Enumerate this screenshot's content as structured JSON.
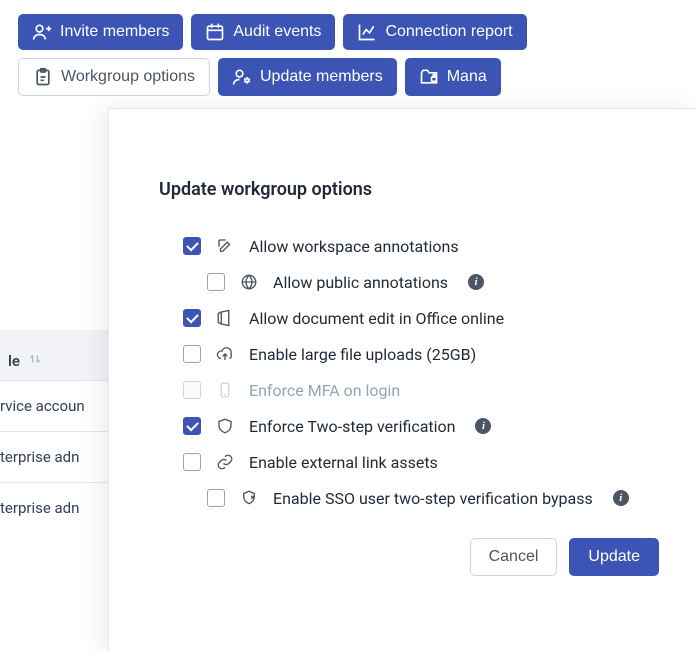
{
  "toolbar": {
    "invite_label": "Invite members",
    "audit_label": "Audit events",
    "conn_report_label": "Connection report",
    "workgroup_options_label": "Workgroup options",
    "update_members_label": "Update members",
    "manage_label": "Mana"
  },
  "bg": {
    "col_header": "le",
    "rows": [
      "rvice accoun",
      "terprise adn",
      "terprise adn"
    ]
  },
  "modal": {
    "title": "Update workgroup options",
    "cancel_label": "Cancel",
    "submit_label": "Update",
    "options": {
      "annotations": "Allow workspace annotations",
      "public_annotations": "Allow public annotations",
      "office": "Allow document edit in Office online",
      "large_upload": "Enable large file uploads (25GB)",
      "mfa": "Enforce MFA on login",
      "twostep": "Enforce Two-step verification",
      "external_link": "Enable external link assets",
      "sso_bypass": "Enable SSO user two-step verification bypass"
    }
  }
}
